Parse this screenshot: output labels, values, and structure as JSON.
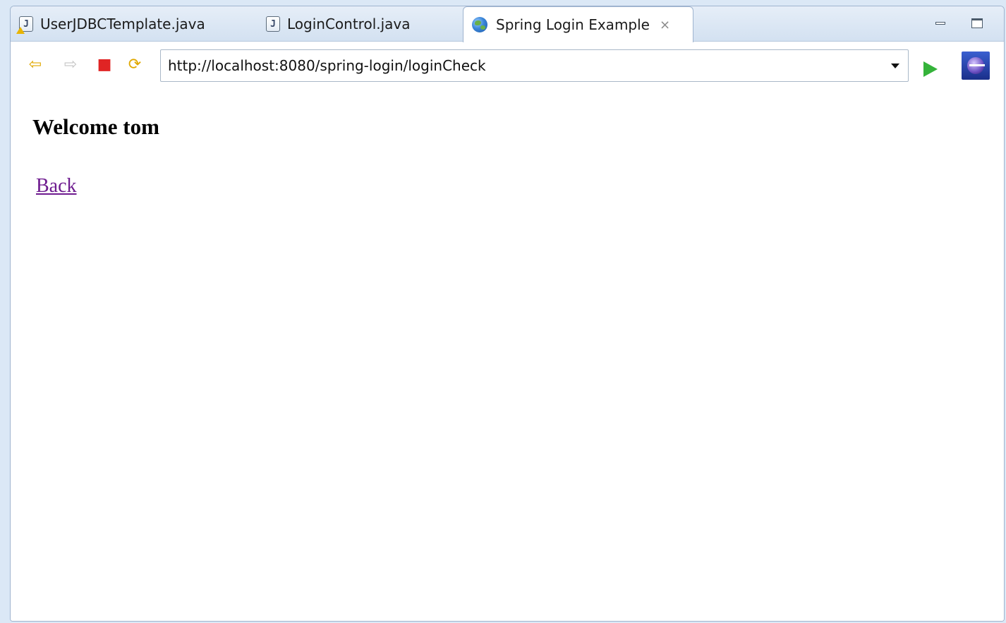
{
  "tabs": [
    {
      "label": "UserJDBCTemplate.java",
      "icon": "java-file-warning-icon"
    },
    {
      "label": "LoginControl.java",
      "icon": "java-file-icon"
    },
    {
      "label": "Spring Login Example",
      "icon": "globe-icon",
      "active": true
    }
  ],
  "tab_close_glyph": "⨯",
  "jicon_letter": "J",
  "toolbar": {
    "back_glyph": "⇦",
    "forward_glyph": "⇨",
    "stop_glyph": "■",
    "refresh_glyph": "⟳"
  },
  "address_bar": {
    "url": "http://localhost:8080/spring-login/loginCheck"
  },
  "page": {
    "heading": "Welcome tom",
    "back_link": "Back"
  },
  "colors": {
    "link_visited": "#6e1b8f",
    "go_green": "#35b33a",
    "stop_red": "#e02424"
  }
}
